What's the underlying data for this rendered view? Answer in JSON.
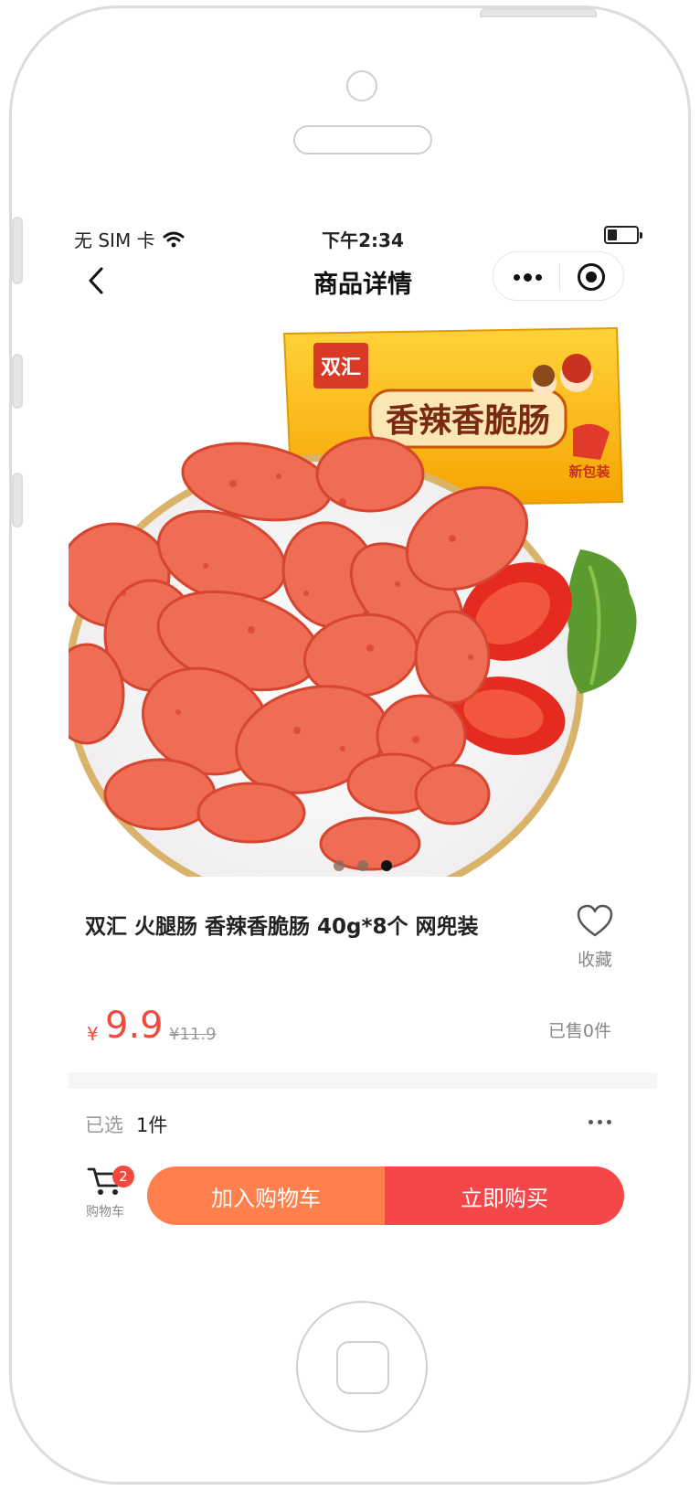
{
  "status_bar": {
    "carrier": "无 SIM 卡",
    "time": "下午2:34"
  },
  "nav": {
    "title": "商品详情"
  },
  "gallery": {
    "package_brand": "双汇",
    "package_name": "香辣香脆肠",
    "package_tag": "新包装",
    "slide_count": 3,
    "active_slide": 3
  },
  "product": {
    "title": "双汇 火腿肠 香辣香脆肠 40g*8个 网兜装",
    "favorite_label": "收藏",
    "currency_symbol": "¥",
    "price": "9.9",
    "original_price": "¥11.9",
    "sold_text": "已售0件"
  },
  "spec": {
    "label": "已选",
    "value": "1件"
  },
  "bottom_bar": {
    "cart_label": "购物车",
    "cart_badge": "2",
    "add_to_cart_label": "加入购物车",
    "buy_now_label": "立即购买"
  },
  "colors": {
    "price_red": "#f04a3e",
    "add_to_cart_orange": "#ff7f4d",
    "buy_now_red": "#f5464a"
  }
}
